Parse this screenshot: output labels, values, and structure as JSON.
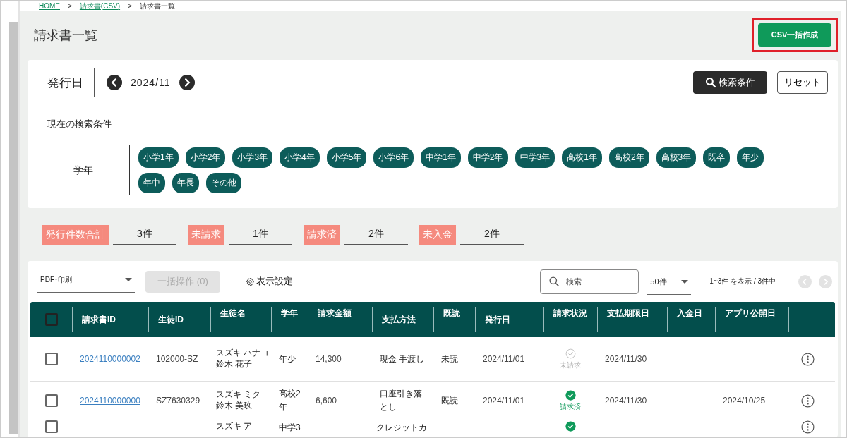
{
  "breadcrumb": [
    {
      "kind": "link",
      "label": "HOME"
    },
    {
      "kind": "separator",
      "label": ">"
    },
    {
      "kind": "link",
      "label": "請求書(CSV)"
    },
    {
      "kind": "separator",
      "label": ">"
    },
    {
      "kind": "current",
      "label": "請求書一覧"
    }
  ],
  "page_title": "請求書一覧",
  "primary_button": "CSV一括作成",
  "filter": {
    "date_label": "発行日",
    "date_value": "2024/11",
    "search_button": "検索条件",
    "reset_button": "リセット",
    "current_conditions_label": "現在の検索条件",
    "grade_label": "学年",
    "grades": [
      "小学1年",
      "小学2年",
      "小学3年",
      "小学4年",
      "小学5年",
      "小学6年",
      "中学1年",
      "中学2年",
      "中学3年",
      "高校1年",
      "高校2年",
      "高校3年",
      "既卒",
      "年少",
      "年中",
      "年長",
      "その他"
    ]
  },
  "summary": [
    {
      "label": "発行件数合計",
      "value": "3件"
    },
    {
      "label": "未請求",
      "value": "1件"
    },
    {
      "label": "請求済",
      "value": "2件"
    },
    {
      "label": "未入金",
      "value": "2件"
    }
  ],
  "toolbar": {
    "print_select": "PDF･印刷",
    "bulk_button": {
      "label": "一括操作 (0)",
      "disabled": true
    },
    "display_settings": "表示設定",
    "search_placeholder": "検索",
    "page_size": "50件",
    "range": "1~3件 を表示 / 3件中",
    "prev_disabled": true,
    "next_disabled": true
  },
  "table": {
    "header_checked": false,
    "columns": [
      "請求書ID",
      "生徒ID",
      "生徒名",
      "学年",
      "請求金額",
      "支払方法",
      "既読",
      "発行日",
      "請求状況",
      "支払期限日",
      "入金日",
      "アプリ公開日"
    ],
    "rows": [
      {
        "checked": false,
        "invoice_id": "2024110000002",
        "student_id": "102000-SZ",
        "kana": "スズキ ハナコ",
        "name": "鈴木 花子",
        "grade": "年少",
        "amount": "14,300",
        "payment": "現金 手渡し",
        "read": "未読",
        "issued": "2024/11/01",
        "kind": "unbilled",
        "status_label": "未請求",
        "due": "2024/11/30"
      },
      {
        "checked": false,
        "invoice_id": "2024110000000",
        "student_id": "SZ7630329",
        "kana": "スズキ ミク",
        "name": "鈴木 美玖",
        "grade": "高校2年",
        "amount": "6,600",
        "payment": "口座引き落とし",
        "read": "既読",
        "issued": "2024/11/01",
        "kind": "billed",
        "status_label": "請求済",
        "due": "2024/11/30",
        "published": "2024/10/25"
      },
      {
        "checked": false,
        "kana": "スズキ ア",
        "grade": "中学3",
        "payment": "クレジットカ",
        "kind": "billed"
      }
    ]
  }
}
